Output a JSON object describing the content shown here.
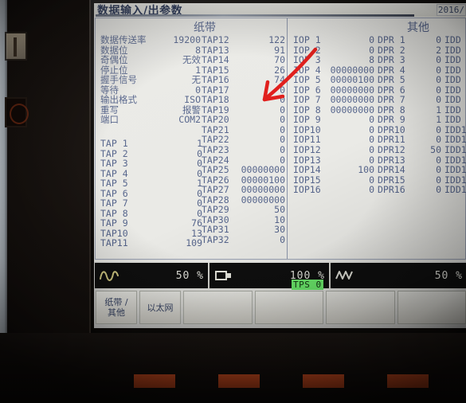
{
  "window": {
    "title": "数据输入/出参数",
    "date": "2016/"
  },
  "sections": {
    "tape_header": "纸带",
    "other_header": "其他"
  },
  "serial_settings": [
    {
      "label": "数据传送率",
      "value": "19200"
    },
    {
      "label": "数据位",
      "value": "8"
    },
    {
      "label": "奇偶位",
      "value": "无效"
    },
    {
      "label": "停止位",
      "value": "1"
    },
    {
      "label": "握手信号",
      "value": "无"
    },
    {
      "label": "等待",
      "value": "0"
    },
    {
      "label": "输出格式",
      "value": "ISO"
    },
    {
      "label": "重写",
      "value": "报警"
    },
    {
      "label": "端口",
      "value": "COM2"
    }
  ],
  "tap_left": [
    {
      "label": "TAP 1",
      "value": "1"
    },
    {
      "label": "TAP 2",
      "value": "0"
    },
    {
      "label": "TAP 3",
      "value": "0"
    },
    {
      "label": "TAP 4",
      "value": "0"
    },
    {
      "label": "TAP 5",
      "value": "1"
    },
    {
      "label": "TAP 6",
      "value": "0"
    },
    {
      "label": "TAP 7",
      "value": "0"
    },
    {
      "label": "TAP 8",
      "value": "0"
    },
    {
      "label": "TAP 9",
      "value": "76"
    },
    {
      "label": "TAP10",
      "value": "13"
    },
    {
      "label": "TAP11",
      "value": "109"
    }
  ],
  "tap_right": [
    {
      "label": "TAP12",
      "value": "122"
    },
    {
      "label": "TAP13",
      "value": "91"
    },
    {
      "label": "TAP14",
      "value": "70"
    },
    {
      "label": "TAP15",
      "value": "26"
    },
    {
      "label": "TAP16",
      "value": "74"
    },
    {
      "label": "TAP17",
      "value": "0"
    },
    {
      "label": "TAP18",
      "value": "0"
    },
    {
      "label": "TAP19",
      "value": "0"
    },
    {
      "label": "TAP20",
      "value": "0"
    },
    {
      "label": "TAP21",
      "value": "0"
    },
    {
      "label": "TAP22",
      "value": "0"
    },
    {
      "label": "TAP23",
      "value": "0"
    },
    {
      "label": "TAP24",
      "value": "0"
    },
    {
      "label": "TAP25",
      "value": "00000000"
    },
    {
      "label": "TAP26",
      "value": "00000100"
    },
    {
      "label": "TAP27",
      "value": "00000000"
    },
    {
      "label": "TAP28",
      "value": "00000000"
    },
    {
      "label": "TAP29",
      "value": "50"
    },
    {
      "label": "TAP30",
      "value": "10"
    },
    {
      "label": "TAP31",
      "value": "30"
    },
    {
      "label": "TAP32",
      "value": "0"
    }
  ],
  "iop": [
    {
      "label": "IOP 1",
      "value": "0"
    },
    {
      "label": "IOP 2",
      "value": "0"
    },
    {
      "label": "IOP 3",
      "value": "8"
    },
    {
      "label": "IOP 4",
      "value": "00000000"
    },
    {
      "label": "IOP 5",
      "value": "00000100"
    },
    {
      "label": "IOP 6",
      "value": "00000000"
    },
    {
      "label": "IOP 7",
      "value": "00000000"
    },
    {
      "label": "IOP 8",
      "value": "00000000"
    },
    {
      "label": "IOP 9",
      "value": "0"
    },
    {
      "label": "IOP10",
      "value": "0"
    },
    {
      "label": "IOP11",
      "value": "0"
    },
    {
      "label": "IOP12",
      "value": "0"
    },
    {
      "label": "IOP13",
      "value": "0"
    },
    {
      "label": "IOP14",
      "value": "100"
    },
    {
      "label": "IOP15",
      "value": "0"
    },
    {
      "label": "IOP16",
      "value": "0"
    }
  ],
  "dpr": [
    {
      "label": "DPR 1",
      "value": "0"
    },
    {
      "label": "DPR 2",
      "value": "2"
    },
    {
      "label": "DPR 3",
      "value": "0"
    },
    {
      "label": "DPR 4",
      "value": "0"
    },
    {
      "label": "DPR 5",
      "value": "0"
    },
    {
      "label": "DPR 6",
      "value": "0"
    },
    {
      "label": "DPR 7",
      "value": "0"
    },
    {
      "label": "DPR 8",
      "value": "1"
    },
    {
      "label": "DPR 9",
      "value": "1"
    },
    {
      "label": "DPR10",
      "value": "0"
    },
    {
      "label": "DPR11",
      "value": "0"
    },
    {
      "label": "DPR12",
      "value": "50"
    },
    {
      "label": "DPR13",
      "value": "0"
    },
    {
      "label": "DPR14",
      "value": "0"
    },
    {
      "label": "DPR15",
      "value": "0"
    },
    {
      "label": "DPR16",
      "value": "0"
    }
  ],
  "idd": [
    {
      "label": "IDD"
    },
    {
      "label": "IDD"
    },
    {
      "label": "IDD"
    },
    {
      "label": "IDD"
    },
    {
      "label": "IDD"
    },
    {
      "label": "IDD"
    },
    {
      "label": "IDD"
    },
    {
      "label": "IDD"
    },
    {
      "label": "IDD"
    },
    {
      "label": "IDD1"
    },
    {
      "label": "IDD1"
    },
    {
      "label": "IDD1"
    },
    {
      "label": "IDD1"
    },
    {
      "label": "IDD1"
    },
    {
      "label": "IDD1"
    },
    {
      "label": "IDD1"
    }
  ],
  "statusbar": {
    "feed_icon": "wave-icon",
    "feed_percent": "50 %",
    "spindle_icon": "spindle-tool-icon",
    "spindle_percent": "100 %",
    "rapid_icon": "zigzag-icon",
    "rapid_percent": "50 %",
    "tps_badge": "TPS 0"
  },
  "softkeys": [
    {
      "line1": "纸带 /",
      "line2": "其他"
    },
    {
      "line1": "以太网",
      "line2": ""
    },
    {
      "line1": "",
      "line2": ""
    },
    {
      "line1": "",
      "line2": ""
    },
    {
      "line1": "",
      "line2": ""
    },
    {
      "line1": "",
      "line2": ""
    }
  ],
  "annotation": {
    "type": "red-arrow",
    "color": "#e01b18",
    "points_at": "IOP 5"
  },
  "hardkeys": [
    "",
    "",
    "",
    "",
    ""
  ]
}
